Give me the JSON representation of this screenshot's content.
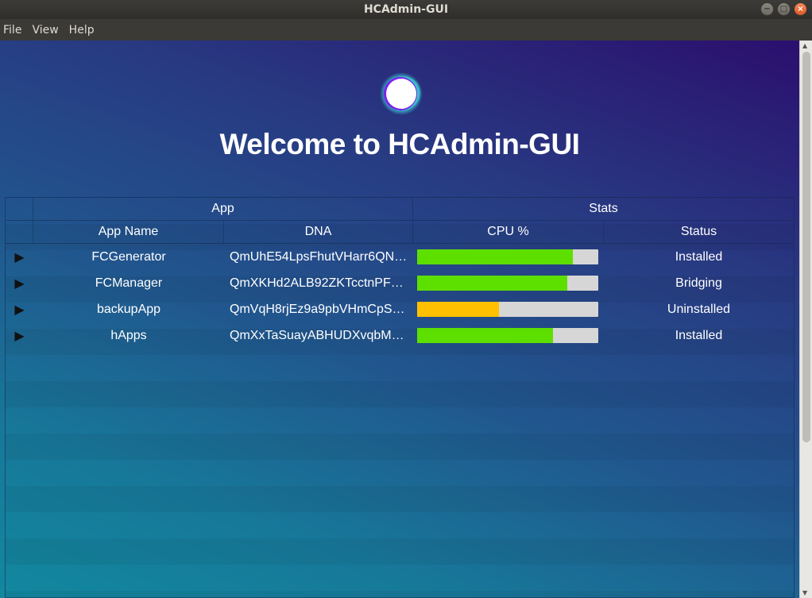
{
  "window": {
    "title": "HCAdmin-GUI",
    "controls": {
      "minimize": "−",
      "maximize": "□",
      "close": "×"
    }
  },
  "menu": {
    "items": [
      "File",
      "View",
      "Help"
    ]
  },
  "main": {
    "welcome_text": "Welcome to HCAdmin-GUI"
  },
  "table": {
    "groups": [
      "App",
      "Stats"
    ],
    "columns": [
      "App Name",
      "DNA",
      "CPU %",
      "Status"
    ],
    "rows": [
      {
        "name": "FCGenerator",
        "dna": "QmUhE54LpsFhutVHarr6QN…",
        "cpu": 0.86,
        "cpu_color": "#5ddf00",
        "status": "Installed"
      },
      {
        "name": "FCManager",
        "dna": "QmXKHd2ALB92ZKTcctnPF…",
        "cpu": 0.83,
        "cpu_color": "#5ddf00",
        "status": "Bridging"
      },
      {
        "name": "backupApp",
        "dna": "QmVqH8rjEz9a9pbVHmCpS…",
        "cpu": 0.45,
        "cpu_color": "#ffc000",
        "status": "Uninstalled"
      },
      {
        "name": "hApps",
        "dna": "QmXxTaSuayABHUDXvqbM…",
        "cpu": 0.75,
        "cpu_color": "#5ddf00",
        "status": "Installed"
      }
    ]
  },
  "colors": {
    "bar_track": "#d6d6d6",
    "cpu_ok": "#5ddf00",
    "cpu_warn": "#ffc000"
  }
}
